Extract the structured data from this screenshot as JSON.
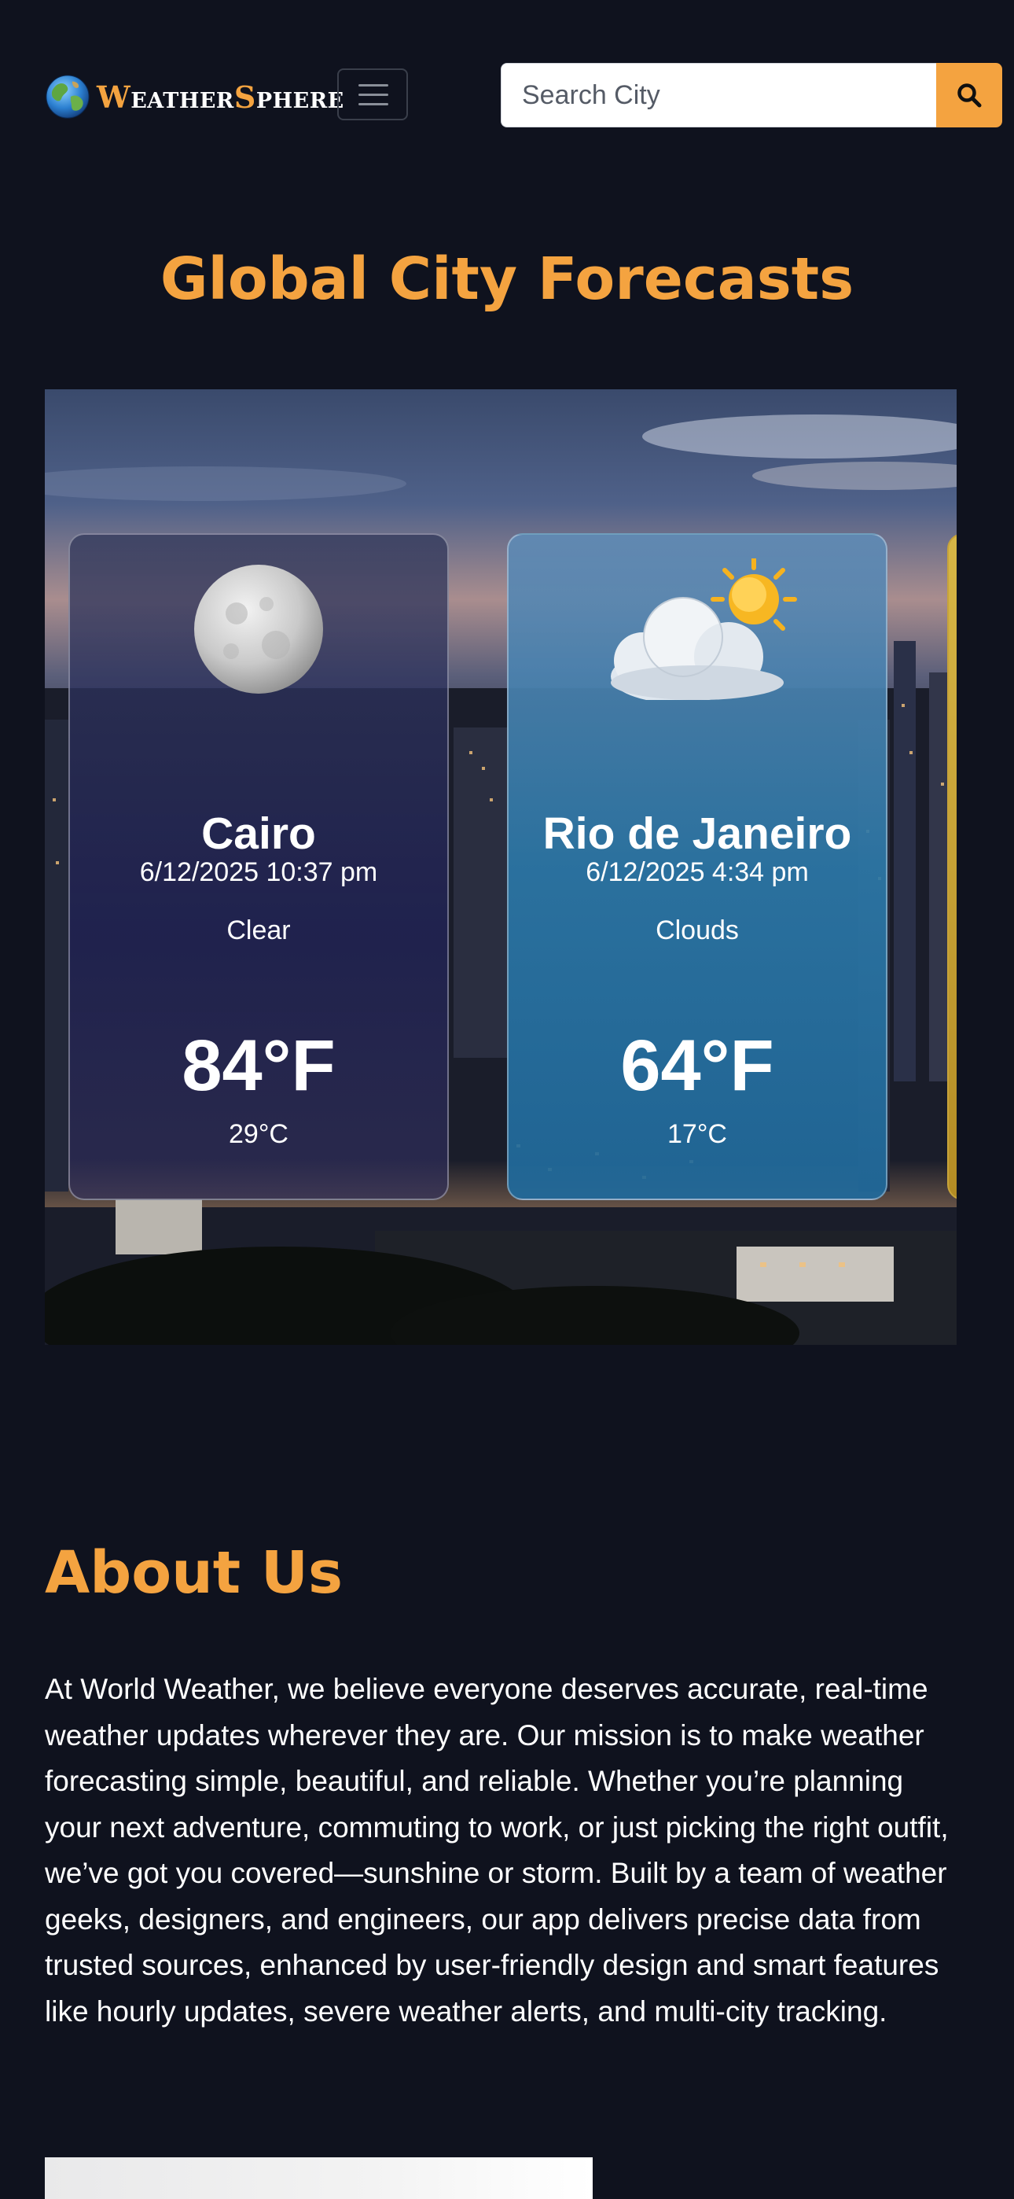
{
  "brand": {
    "first_letter": "W",
    "first_rest": "eather",
    "second_letter": "S",
    "second_rest": "phere"
  },
  "header": {
    "menu_icon": "hamburger-icon",
    "search_placeholder": "Search City",
    "search_icon": "search-icon"
  },
  "forecasts": {
    "title": "Global City Forecasts",
    "cards": [
      {
        "city": "Cairo",
        "datetime": "6/12/2025 10:37 pm",
        "condition": "Clear",
        "temp_f": "84°F",
        "temp_c": "29°C",
        "icon": "moon-icon"
      },
      {
        "city": "Rio de Janeiro",
        "datetime": "6/12/2025 4:34 pm",
        "condition": "Clouds",
        "temp_f": "64°F",
        "temp_c": "17°C",
        "icon": "partly-cloudy-icon"
      }
    ]
  },
  "about": {
    "title": "About Us",
    "body": "At World Weather, we believe everyone deserves accurate, real-time weather updates wherever they are. Our mission is to make weather forecasting simple, beautiful, and reliable. Whether you’re planning your next adventure, commuting to work, or just picking the right outfit, we’ve got you covered—sunshine or storm. Built by a team of weather geeks, designers, and engineers, our app delivers precise data from trusted sources, enhanced by user-friendly design and smart features like hourly updates, severe weather alerts, and multi-city tracking."
  },
  "colors": {
    "background": "#0f121e",
    "accent": "#f4a340",
    "text": "#ffffff"
  }
}
